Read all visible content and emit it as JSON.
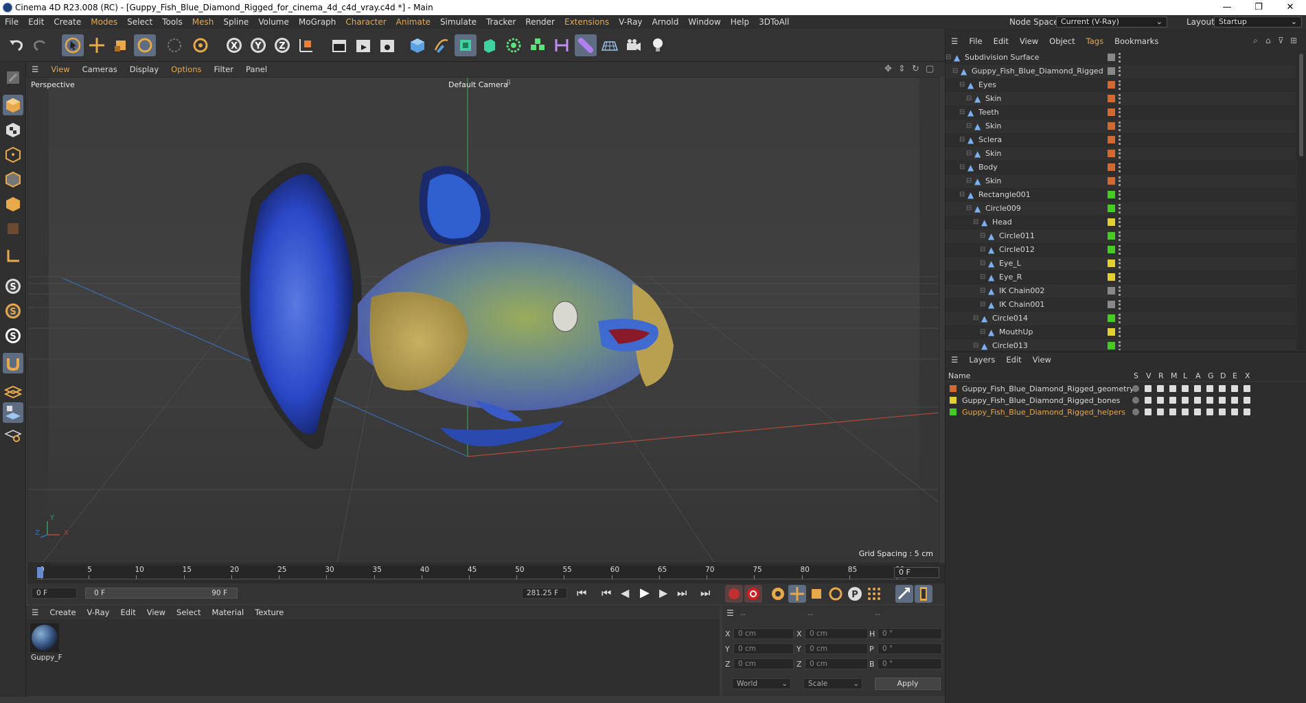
{
  "window": {
    "title": "Cinema 4D R23.008 (RC) - [Guppy_Fish_Blue_Diamond_Rigged_for_cinema_4d_c4d_vray.c4d *] - Main",
    "minimize": "—",
    "restore": "❐",
    "close": "✕"
  },
  "menubar": {
    "items": [
      "File",
      "Edit",
      "Create",
      "Modes",
      "Select",
      "Tools",
      "Mesh",
      "Spline",
      "Volume",
      "MoGraph",
      "Character",
      "Animate",
      "Simulate",
      "Tracker",
      "Render",
      "Extensions",
      "V-Ray",
      "Arnold",
      "Window",
      "Help",
      "3DToAll"
    ],
    "node_space_label": "Node Space:",
    "node_space_value": "Current (V-Ray)",
    "layout_label": "Layout:",
    "layout_value": "Startup"
  },
  "viewport": {
    "menu": [
      "View",
      "Cameras",
      "Display",
      "Options",
      "Filter",
      "Panel"
    ],
    "label": "Perspective",
    "camera": "Default Camera",
    "grid_spacing": "Grid Spacing : 5 cm",
    "axis_y": "Y",
    "axis_x": "X",
    "axis_z": "Z"
  },
  "timeline": {
    "ticks": [
      "0",
      "5",
      "10",
      "15",
      "20",
      "25",
      "30",
      "35",
      "40",
      "45",
      "50",
      "55",
      "60",
      "65",
      "70",
      "75",
      "80",
      "85",
      "90"
    ],
    "current_frame_right": "0 F",
    "start_field": "0 F",
    "range_start": "0 F",
    "range_end": "90 F",
    "fps_field": "281.25 F"
  },
  "material_manager": {
    "menu": [
      "Create",
      "V-Ray",
      "Edit",
      "View",
      "Select",
      "Material",
      "Texture"
    ],
    "material_name": "Guppy_F"
  },
  "coordinates": {
    "header_dashes": [
      "--",
      "--",
      "--"
    ],
    "rows": [
      {
        "a": "X",
        "av": "0 cm",
        "b": "X",
        "bv": "0 cm",
        "c": "H",
        "cv": "0 °"
      },
      {
        "a": "Y",
        "av": "0 cm",
        "b": "Y",
        "bv": "0 cm",
        "c": "P",
        "cv": "0 °"
      },
      {
        "a": "Z",
        "av": "0 cm",
        "b": "Z",
        "bv": "0 cm",
        "c": "B",
        "cv": "0 °"
      }
    ],
    "mode_world": "World",
    "mode_scale": "Scale",
    "apply": "Apply"
  },
  "object_manager": {
    "menu": [
      "File",
      "Edit",
      "View",
      "Object",
      "Tags",
      "Bookmarks"
    ],
    "objects": [
      {
        "name": "Subdivision Surface",
        "indent": 0,
        "color": "#888888"
      },
      {
        "name": "Guppy_Fish_Blue_Diamond_Rigged",
        "indent": 1,
        "color": "#888888"
      },
      {
        "name": "Eyes",
        "indent": 2,
        "color": "#d06a30"
      },
      {
        "name": "Skin",
        "indent": 3,
        "color": "#d06a30"
      },
      {
        "name": "Teeth",
        "indent": 2,
        "color": "#d06a30"
      },
      {
        "name": "Skin",
        "indent": 3,
        "color": "#d06a30"
      },
      {
        "name": "Sclera",
        "indent": 2,
        "color": "#d06a30"
      },
      {
        "name": "Skin",
        "indent": 3,
        "color": "#d06a30"
      },
      {
        "name": "Body",
        "indent": 2,
        "color": "#d06a30"
      },
      {
        "name": "Skin",
        "indent": 3,
        "color": "#d06a30"
      },
      {
        "name": "Rectangle001",
        "indent": 2,
        "color": "#44cc22"
      },
      {
        "name": "Circle009",
        "indent": 3,
        "color": "#44cc22"
      },
      {
        "name": "Head",
        "indent": 4,
        "color": "#e0d030"
      },
      {
        "name": "Circle011",
        "indent": 5,
        "color": "#44cc22"
      },
      {
        "name": "Circle012",
        "indent": 5,
        "color": "#44cc22"
      },
      {
        "name": "Eye_L",
        "indent": 5,
        "color": "#e0d030"
      },
      {
        "name": "Eye_R",
        "indent": 5,
        "color": "#e0d030"
      },
      {
        "name": "IK Chain002",
        "indent": 5,
        "color": "#888888"
      },
      {
        "name": "IK Chain001",
        "indent": 5,
        "color": "#888888"
      },
      {
        "name": "Circle014",
        "indent": 4,
        "color": "#44cc22"
      },
      {
        "name": "MouthUp",
        "indent": 5,
        "color": "#e0d030"
      },
      {
        "name": "Circle013",
        "indent": 4,
        "color": "#44cc22"
      }
    ]
  },
  "layer_manager": {
    "menu": [
      "Layers",
      "Edit",
      "View"
    ],
    "col_name": "Name",
    "col_flags": [
      "S",
      "V",
      "R",
      "M",
      "L",
      "A",
      "G",
      "D",
      "E",
      "X"
    ],
    "layers": [
      {
        "name": "Guppy_Fish_Blue_Diamond_Rigged_geometry",
        "color": "#d06a30",
        "selected": false
      },
      {
        "name": "Guppy_Fish_Blue_Diamond_Rigged_bones",
        "color": "#e0d030",
        "selected": false
      },
      {
        "name": "Guppy_Fish_Blue_Diamond_Rigged_helpers",
        "color": "#44cc22",
        "selected": true
      }
    ]
  }
}
